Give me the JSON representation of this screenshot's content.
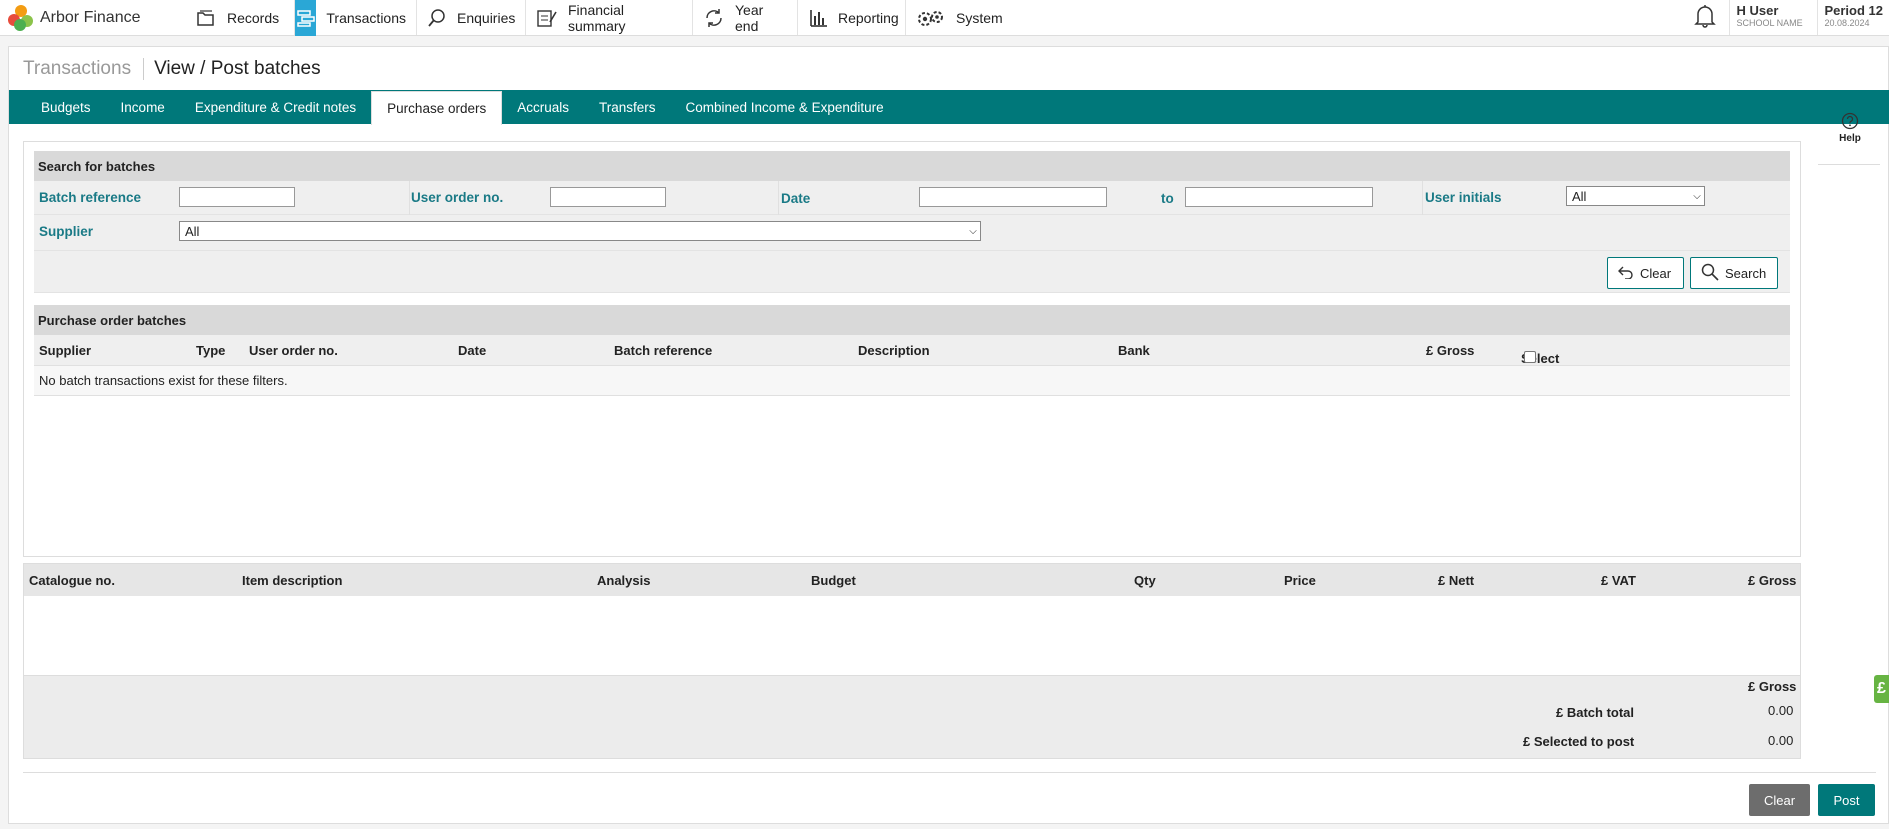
{
  "app": {
    "name": "Arbor Finance"
  },
  "nav": [
    {
      "label": "Records",
      "icon": "folder-icon"
    },
    {
      "label": "Transactions",
      "icon": "transactions-icon",
      "active": true
    },
    {
      "label": "Enquiries",
      "icon": "search-icon"
    },
    {
      "label": "Financial summary",
      "icon": "summary-icon"
    },
    {
      "label": "Year end",
      "icon": "cycle-icon"
    },
    {
      "label": "Reporting",
      "icon": "bar-chart-icon"
    },
    {
      "label": "System",
      "icon": "gears-icon"
    }
  ],
  "user": {
    "name": "H User",
    "school": "SCHOOL NAME"
  },
  "period": {
    "label": "Period 12",
    "date": "20.08.2024"
  },
  "breadcrumb": {
    "section": "Transactions",
    "page": "View / Post batches"
  },
  "tabs": [
    {
      "label": "Budgets"
    },
    {
      "label": "Income"
    },
    {
      "label": "Expenditure & Credit notes"
    },
    {
      "label": "Purchase orders",
      "active": true
    },
    {
      "label": "Accruals"
    },
    {
      "label": "Transfers"
    },
    {
      "label": "Combined Income & Expenditure"
    }
  ],
  "search": {
    "title": "Search for batches",
    "batch_reference_label": "Batch reference",
    "batch_reference_value": "",
    "user_order_label": "User order no.",
    "user_order_value": "",
    "date_label": "Date",
    "date_from": "",
    "to_label": "to",
    "date_to": "",
    "user_initials_label": "User initials",
    "user_initials_value": "All",
    "supplier_label": "Supplier",
    "supplier_value": "All",
    "clear_label": "Clear",
    "search_label": "Search"
  },
  "batches": {
    "title": "Purchase order batches",
    "columns": [
      "Supplier",
      "Type",
      "User order no.",
      "Date",
      "Batch reference",
      "Description",
      "Bank",
      "£ Gross",
      "Select"
    ],
    "empty_message": "No batch transactions exist for these filters."
  },
  "items": {
    "columns": [
      "Catalogue no.",
      "Item description",
      "Analysis",
      "Budget",
      "Qty",
      "Price",
      "£ Nett",
      "£ VAT",
      "£ Gross"
    ],
    "totals_header": "£ Gross",
    "batch_total_label": "£ Batch total",
    "batch_total_value": "0.00",
    "selected_label": "£ Selected to post",
    "selected_value": "0.00"
  },
  "footer": {
    "clear_label": "Clear",
    "post_label": "Post"
  },
  "help": {
    "label": "Help"
  },
  "side_tab": {
    "label": "£"
  },
  "colors": {
    "teal": "#00787a",
    "active_nav": "#2aa7d6",
    "label_teal": "#1a7a86",
    "clear_grey": "#6d6d6d",
    "side_tab_green": "#67b443"
  }
}
